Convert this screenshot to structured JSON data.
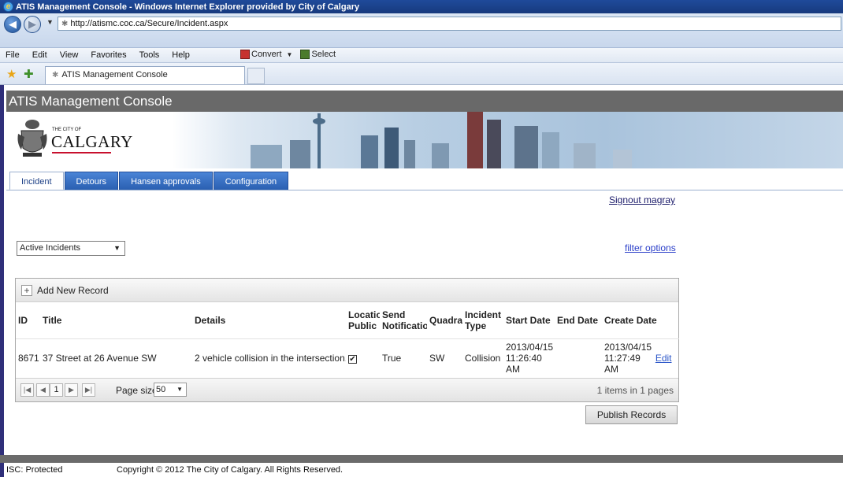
{
  "window": {
    "title": "ATIS Management Console - Windows Internet Explorer provided by City of Calgary"
  },
  "address": {
    "url": "http://atismc.coc.ca/Secure/Incident.aspx"
  },
  "menu": {
    "items": [
      "File",
      "Edit",
      "View",
      "Favorites",
      "Tools",
      "Help"
    ],
    "convert": "Convert",
    "select": "Select"
  },
  "browser_tab": {
    "title": "ATIS Management Console"
  },
  "app": {
    "header": "ATIS Management Console",
    "logo_small": "THE CITY OF",
    "logo_big": "CALGARY",
    "tabs": [
      "Incident",
      "Detours",
      "Hansen approvals",
      "Configuration"
    ],
    "signout": "Signout magray",
    "filter_select": "Active Incidents",
    "filter_options": "filter options"
  },
  "grid": {
    "add_label": "Add New Record",
    "columns": [
      "ID",
      "Title",
      "Details",
      "Location Public",
      "Send Notification",
      "Quadrant",
      "Incident Type",
      "Start Date",
      "End Date",
      "Create Date"
    ],
    "rows": [
      {
        "id": "8671",
        "title": "37 Street at 26 Avenue SW",
        "details": "2 vehicle collision in the intersection.",
        "location_public": "✔",
        "send_notification": "True",
        "quadrant": "SW",
        "incident_type": "Collision",
        "start_date_1": "2013/04/15",
        "start_date_2": "11:26:40",
        "start_date_3": "AM",
        "end_date": "",
        "create_date_1": "2013/04/15",
        "create_date_2": "11:27:49",
        "create_date_3": "AM",
        "edit": "Edit"
      }
    ],
    "pager": {
      "current_page": "1",
      "page_size_label": "Page size:",
      "page_size": "50",
      "info": "1 items in 1 pages"
    }
  },
  "publish": "Publish Records",
  "footer": {
    "classification": "ISC: Protected",
    "copyright": "Copyright © 2012 The City of Calgary. All Rights Reserved."
  }
}
